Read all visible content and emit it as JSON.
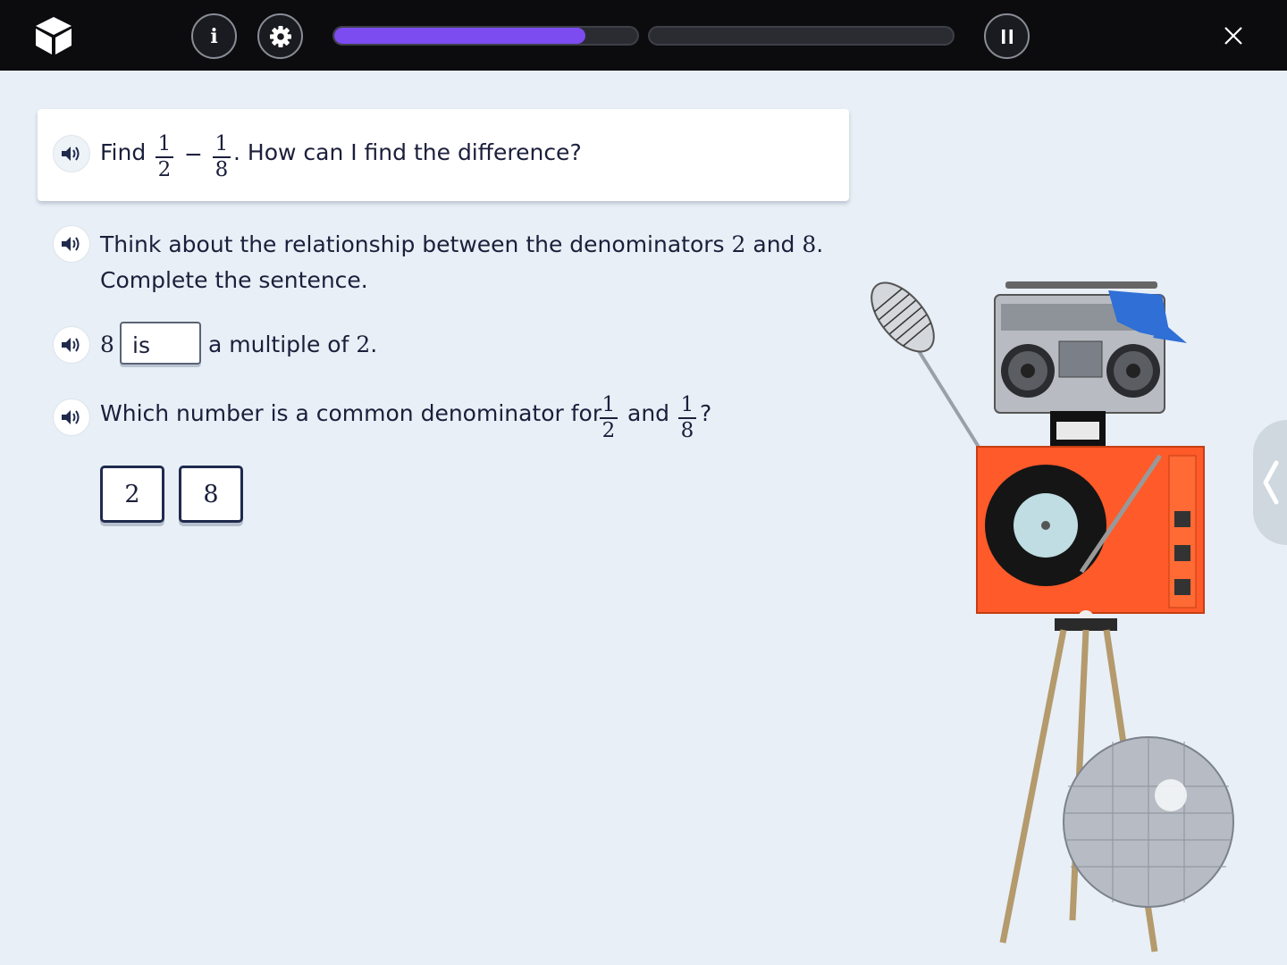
{
  "topbar": {
    "logo_icon": "cube-logo-icon",
    "info_label": "i",
    "progress": [
      0.83,
      0.0
    ],
    "accent_color": "#7c4cf0"
  },
  "question": {
    "find_label": "Find",
    "minus": "−",
    "frac1": {
      "num": "1",
      "den": "2"
    },
    "frac2": {
      "num": "1",
      "den": "8"
    },
    "rest": ". How can I find the difference?"
  },
  "hint": {
    "line1_a": "Think about the relationship between the denominators",
    "den_a": "2",
    "and": "and",
    "den_b": "8",
    "period": ".",
    "line2": "Complete the sentence."
  },
  "sentence": {
    "lead": "8",
    "answer": "is",
    "tail_text": "a multiple of",
    "tail_num": "2",
    "period": "."
  },
  "common": {
    "prompt": "Which number is a common denominator for",
    "frac1": {
      "num": "1",
      "den": "2"
    },
    "and": "and",
    "frac2": {
      "num": "1",
      "den": "8"
    },
    "qmark": "?"
  },
  "choices": [
    "2",
    "8"
  ]
}
